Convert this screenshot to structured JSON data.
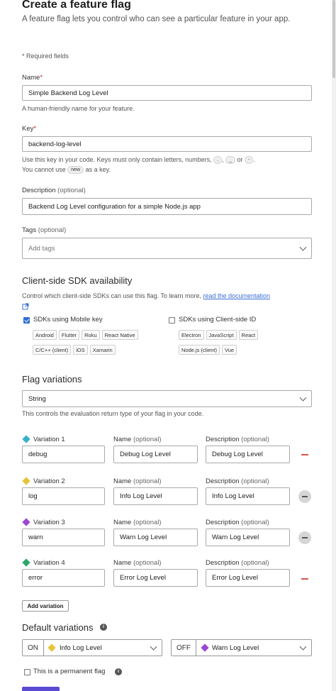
{
  "header": {
    "title": "Create a feature flag",
    "intro": "A feature flag lets you control who can see a particular feature in your app.",
    "required_note": "* Required fields"
  },
  "name_field": {
    "label": "Name",
    "required_mark": "*",
    "value": "Simple Backend Log Level",
    "help": "A human-friendly name for your feature."
  },
  "key_field": {
    "label": "Key",
    "required_mark": "*",
    "value": "backend-log-level",
    "help_prefix": "Use this key in your code. Keys must only contain letters, numbers,",
    "allowed_chars": [
      ".",
      "_",
      "-"
    ],
    "help_or": "or",
    "help_cannot": "You cannot use",
    "reserved_word": "new",
    "help_suffix": "as a key."
  },
  "description_field": {
    "label": "Description",
    "optional": "(optional)",
    "value": "Backend Log Level configuration for a simple Node.js app"
  },
  "tags_field": {
    "label": "Tags",
    "optional": "(optional)",
    "placeholder": "Add tags"
  },
  "sdk_section": {
    "title": "Client-side SDK availability",
    "help": "Control which client-side SDKs can use this flag. To learn more,",
    "link": "read the documentation",
    "mobile": {
      "label": "SDKs using Mobile key",
      "checked": true,
      "sdks_row1": [
        "Android",
        "Flutter",
        "Roku",
        "React Native"
      ],
      "sdks_row2": [
        "C/C++ (client)",
        "iOS",
        "Xamarin"
      ]
    },
    "client": {
      "label": "SDKs using Client-side ID",
      "checked": false,
      "sdks_row1": [
        "Electron",
        "JavaScript",
        "React"
      ],
      "sdks_row2": [
        "Node.js (client)",
        "Vue"
      ]
    }
  },
  "variations_section": {
    "title": "Flag variations",
    "type_value": "String",
    "type_help": "This controls the evaluation return type of your flag in your code.",
    "name_header": "Name",
    "desc_header": "Description",
    "optional": "(optional)",
    "variations": [
      {
        "label": "Variation 1",
        "color": "#3ab0c9",
        "value": "debug",
        "name": "Debug Log Level",
        "description": "Debug Log Level"
      },
      {
        "label": "Variation 2",
        "color": "#e8c33a",
        "value": "log",
        "name": "Info Log Level",
        "description": "Info Log Level"
      },
      {
        "label": "Variation 3",
        "color": "#9b48d6",
        "value": "warn",
        "name": "Warn Log Level",
        "description": "Warn Log Level"
      },
      {
        "label": "Variation 4",
        "color": "#2ea66a",
        "value": "error",
        "name": "Error Log Level",
        "description": "Error Log Level"
      }
    ],
    "add_button": "Add variation"
  },
  "defaults_section": {
    "title": "Default variations",
    "on_label": "ON",
    "on_value": "Info Log Level",
    "on_color": "#e8c33a",
    "off_label": "OFF",
    "off_value": "Warn Log Level",
    "off_color": "#9b48d6"
  },
  "permanent": {
    "label": "This is a permanent flag",
    "checked": false
  },
  "colors": {
    "accent": "#2f6fd6",
    "remove_red": "#d9534f"
  }
}
